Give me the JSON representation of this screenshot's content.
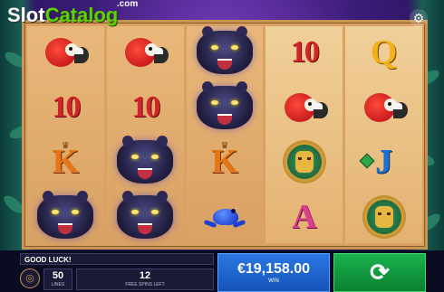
{
  "watermark": {
    "part1": "Slot",
    "part2": "Catalog",
    "suffix": ".com"
  },
  "icons": {
    "settings": "settings-icon",
    "coin": "coin-icon",
    "spin": "refresh-icon"
  },
  "reels": [
    {
      "symbols": [
        "parrot",
        "10",
        "K",
        "panther"
      ]
    },
    {
      "symbols": [
        "parrot",
        "10",
        "panther",
        "panther"
      ]
    },
    {
      "symbols": [
        "panther",
        "panther",
        "K",
        "frog"
      ]
    },
    {
      "symbols": [
        "10",
        "parrot",
        "mask",
        "A"
      ]
    },
    {
      "symbols": [
        "Q",
        "parrot",
        "J",
        "mask"
      ]
    }
  ],
  "reel_labels": {
    "ten": "10",
    "k": "K",
    "q": "Q",
    "j": "J",
    "a": "A"
  },
  "status": {
    "message": "GOOD LUCK!",
    "lines_value": "50",
    "lines_label": "LINES",
    "free_spins_value": "12",
    "free_spins_label": "FREE SPINS LEFT",
    "win_value": "€19,158.00",
    "win_label": "WIN"
  },
  "colors": {
    "win_panel": "#2b78e4",
    "spin_button": "#19b34d",
    "frame": "#d9a163"
  }
}
